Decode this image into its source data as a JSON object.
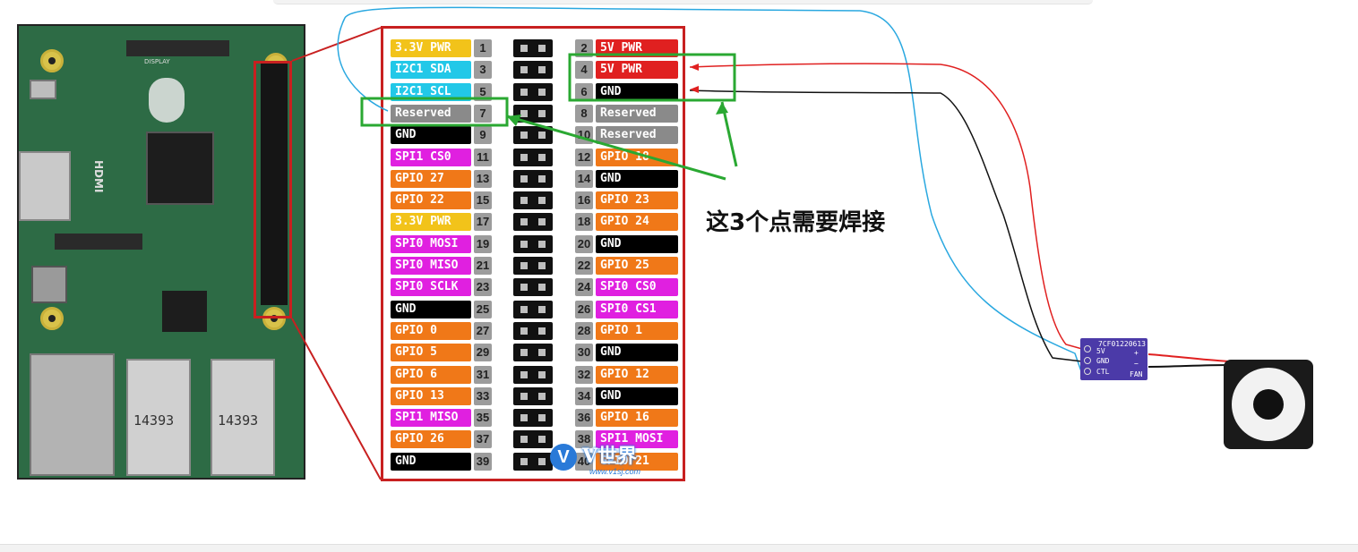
{
  "pinout": {
    "left": [
      {
        "label": "3.3V PWR",
        "num": "1",
        "color": "#f2c31a"
      },
      {
        "label": "I2C1 SDA",
        "num": "3",
        "color": "#22c8e8"
      },
      {
        "label": "I2C1 SCL",
        "num": "5",
        "color": "#22c8e8"
      },
      {
        "label": "Reserved",
        "num": "7",
        "color": "#8a8a8a"
      },
      {
        "label": "GND",
        "num": "9",
        "color": "#000000"
      },
      {
        "label": "SPI1 CS0",
        "num": "11",
        "color": "#e020e0"
      },
      {
        "label": "GPIO 27",
        "num": "13",
        "color": "#f07818"
      },
      {
        "label": "GPIO 22",
        "num": "15",
        "color": "#f07818"
      },
      {
        "label": "3.3V PWR",
        "num": "17",
        "color": "#f2c31a"
      },
      {
        "label": "SPI0 MOSI",
        "num": "19",
        "color": "#e020e0"
      },
      {
        "label": "SPI0 MISO",
        "num": "21",
        "color": "#e020e0"
      },
      {
        "label": "SPI0 SCLK",
        "num": "23",
        "color": "#e020e0"
      },
      {
        "label": "GND",
        "num": "25",
        "color": "#000000"
      },
      {
        "label": "GPIO 0",
        "num": "27",
        "color": "#f07818"
      },
      {
        "label": "GPIO 5",
        "num": "29",
        "color": "#f07818"
      },
      {
        "label": "GPIO 6",
        "num": "31",
        "color": "#f07818"
      },
      {
        "label": "GPIO 13",
        "num": "33",
        "color": "#f07818"
      },
      {
        "label": "SPI1 MISO",
        "num": "35",
        "color": "#e020e0"
      },
      {
        "label": "GPIO 26",
        "num": "37",
        "color": "#f07818"
      },
      {
        "label": "GND",
        "num": "39",
        "color": "#000000"
      }
    ],
    "right": [
      {
        "label": "5V PWR",
        "num": "2",
        "color": "#e02020"
      },
      {
        "label": "5V PWR",
        "num": "4",
        "color": "#e02020"
      },
      {
        "label": "GND",
        "num": "6",
        "color": "#000000"
      },
      {
        "label": "Reserved",
        "num": "8",
        "color": "#8a8a8a"
      },
      {
        "label": "Reserved",
        "num": "10",
        "color": "#8a8a8a"
      },
      {
        "label": "GPIO 18",
        "num": "12",
        "color": "#f07818"
      },
      {
        "label": "GND",
        "num": "14",
        "color": "#000000"
      },
      {
        "label": "GPIO 23",
        "num": "16",
        "color": "#f07818"
      },
      {
        "label": "GPIO 24",
        "num": "18",
        "color": "#f07818"
      },
      {
        "label": "GND",
        "num": "20",
        "color": "#000000"
      },
      {
        "label": "GPIO 25",
        "num": "22",
        "color": "#f07818"
      },
      {
        "label": "SPI0 CS0",
        "num": "24",
        "color": "#e020e0"
      },
      {
        "label": "SPI0 CS1",
        "num": "26",
        "color": "#e020e0"
      },
      {
        "label": "GPIO 1",
        "num": "28",
        "color": "#f07818"
      },
      {
        "label": "GND",
        "num": "30",
        "color": "#000000"
      },
      {
        "label": "GPIO 12",
        "num": "32",
        "color": "#f07818"
      },
      {
        "label": "GND",
        "num": "34",
        "color": "#000000"
      },
      {
        "label": "GPIO 16",
        "num": "36",
        "color": "#f07818"
      },
      {
        "label": "SPI1 MOSI",
        "num": "38",
        "color": "#e020e0"
      },
      {
        "label": "GPIO 21",
        "num": "40",
        "color": "#f07818"
      }
    ]
  },
  "annotation": {
    "note": "这3个点需要焊接",
    "highlight_color": "#2aa832"
  },
  "watermark": {
    "brand": "V世界",
    "url": "www.v1sj.com"
  },
  "fan_board": {
    "code": "7CF01220613",
    "pin_5v": "5V",
    "pin_gnd": "GND",
    "pin_ctl": "CTL",
    "plus": "+",
    "minus": "−",
    "fan": "FAN"
  },
  "board_photo": {
    "silkscreen_display": "DISPLAY",
    "silkscreen_hdmi": "HDMI",
    "usb_label_1": "14393",
    "usb_label_2": "14393"
  },
  "wire_colors": {
    "red": "#e02020",
    "black": "#111111",
    "blue": "#2aa8e0"
  }
}
